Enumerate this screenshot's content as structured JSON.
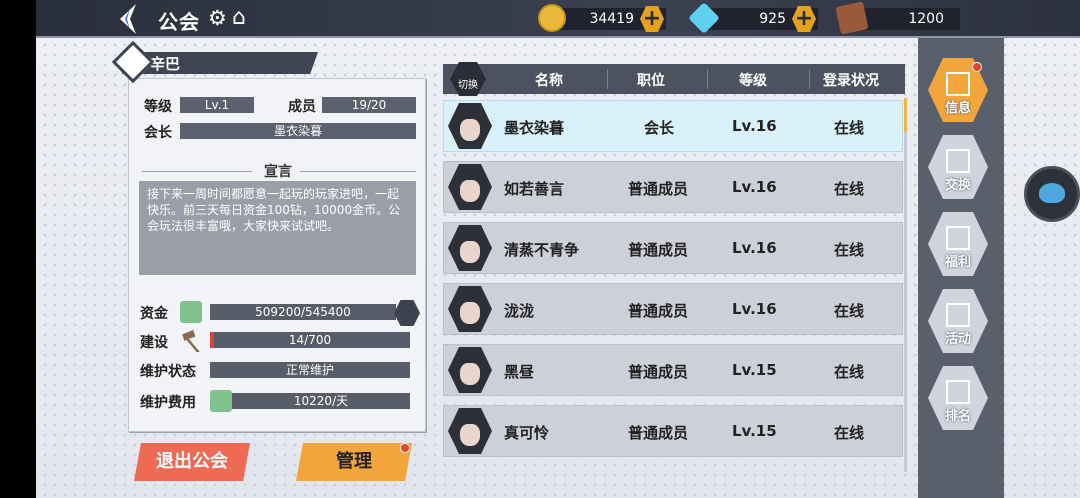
{
  "header": {
    "title": "公会",
    "gold": "34419",
    "diamond": "925",
    "ticket": "1200"
  },
  "guild": {
    "name": "辛巴",
    "level_label": "等级",
    "level": "Lv.1",
    "member_label": "成员",
    "members": "19/20",
    "leader_label": "会长",
    "leader": "墨衣染暮",
    "decl_title": "宣言",
    "declaration": "接下来一周时间都愿意一起玩的玩家进吧，一起快乐。前三天每日资金100钻，10000金币。公会玩法很丰富哦，大家快来试试吧。",
    "funds_label": "资金",
    "funds": "509200/545400",
    "build_label": "建设",
    "build": "14/700",
    "build_progress": 0.02,
    "maint_label": "维护状态",
    "maint": "正常维护",
    "fee_label": "维护费用",
    "fee": "10220/天"
  },
  "buttons": {
    "quit": "退出公会",
    "manage": "管理",
    "switch": "切换"
  },
  "table": {
    "headers": [
      "名称",
      "职位",
      "等级",
      "登录状况"
    ],
    "rows": [
      {
        "name": "墨衣染暮",
        "role": "会长",
        "level": "Lv.16",
        "status": "在线"
      },
      {
        "name": "如若善言",
        "role": "普通成员",
        "level": "Lv.16",
        "status": "在线"
      },
      {
        "name": "清蒸不青争",
        "role": "普通成员",
        "level": "Lv.16",
        "status": "在线"
      },
      {
        "name": "泷泷",
        "role": "普通成员",
        "level": "Lv.16",
        "status": "在线"
      },
      {
        "name": "黑昼",
        "role": "普通成员",
        "level": "Lv.15",
        "status": "在线"
      },
      {
        "name": "真可怜",
        "role": "普通成员",
        "level": "Lv.15",
        "status": "在线"
      }
    ]
  },
  "tabs": [
    "信息",
    "交换",
    "福利",
    "活动",
    "排名"
  ],
  "colors": {
    "accent": "#f2a53a",
    "quit": "#ef6a55",
    "header": "#4d5261"
  }
}
